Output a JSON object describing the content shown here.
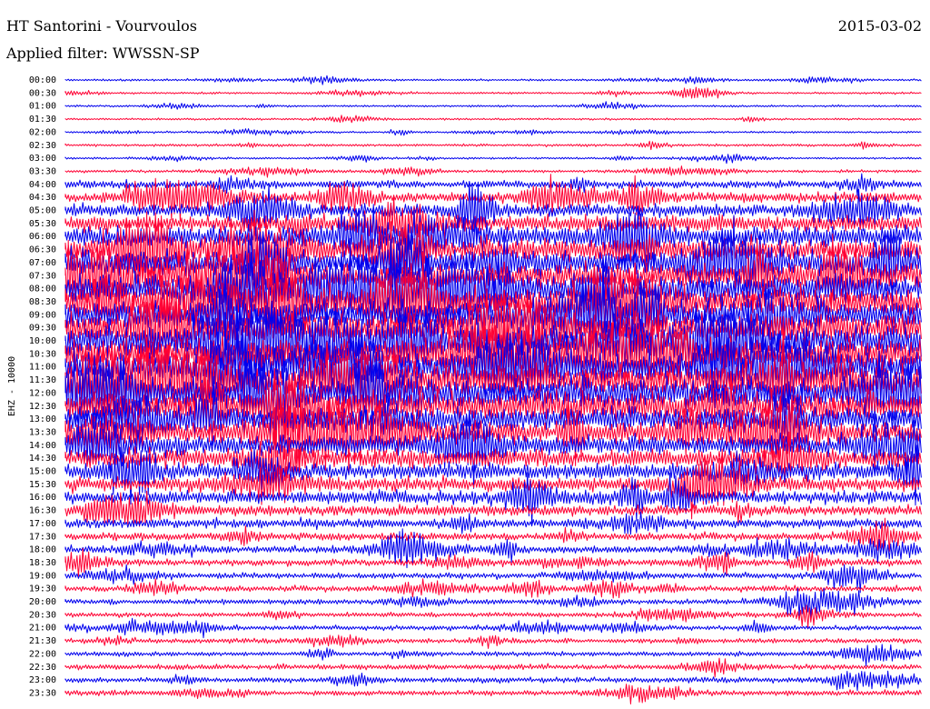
{
  "header": {
    "station": "HT Santorini - Vourvoulos",
    "date": "2015-03-02",
    "filter": "Applied filter: WWSSN-SP"
  },
  "colors": {
    "blue": "#0000ee",
    "red": "#ff0033",
    "background": "#ffffff"
  },
  "chart_data": {
    "type": "line",
    "title": "HT Santorini - Vourvoulos",
    "ylabel": "EHZ - 10000",
    "row_labels": [
      "00:00",
      "00:30",
      "01:00",
      "01:30",
      "02:00",
      "02:30",
      "03:00",
      "03:30",
      "04:00",
      "04:30",
      "05:00",
      "05:30",
      "06:00",
      "06:30",
      "07:00",
      "07:30",
      "08:00",
      "08:30",
      "09:00",
      "09:30",
      "10:00",
      "10:30",
      "11:00",
      "11:30",
      "12:00",
      "12:30",
      "13:00",
      "13:30",
      "14:00",
      "14:30",
      "15:00",
      "15:30",
      "16:00",
      "16:30",
      "17:00",
      "17:30",
      "18:00",
      "18:30",
      "19:00",
      "19:30",
      "20:00",
      "20:30",
      "21:00",
      "21:30",
      "22:00",
      "22:30",
      "23:00",
      "23:30"
    ],
    "row_colors": [
      "blue",
      "red",
      "blue",
      "red",
      "blue",
      "red",
      "blue",
      "red",
      "blue",
      "red",
      "blue",
      "red",
      "blue",
      "red",
      "blue",
      "red",
      "blue",
      "red",
      "blue",
      "red",
      "blue",
      "red",
      "blue",
      "red",
      "blue",
      "red",
      "blue",
      "red",
      "blue",
      "red",
      "blue",
      "red",
      "blue",
      "red",
      "blue",
      "red",
      "blue",
      "red",
      "blue",
      "red",
      "blue",
      "red",
      "blue",
      "red",
      "blue",
      "red",
      "blue",
      "red"
    ],
    "noise_level": [
      0.3,
      0.3,
      0.3,
      0.3,
      0.3,
      0.4,
      0.3,
      0.4,
      1.2,
      1.5,
      2.0,
      2.5,
      3.2,
      3.5,
      4.0,
      4.2,
      4.5,
      4.5,
      4.6,
      4.8,
      5.0,
      5.0,
      5.0,
      5.0,
      4.8,
      4.5,
      4.0,
      3.5,
      3.0,
      2.8,
      2.5,
      2.2,
      2.0,
      1.6,
      1.4,
      1.2,
      1.1,
      1.0,
      0.9,
      0.9,
      0.8,
      0.7,
      0.7,
      0.7,
      0.7,
      0.8,
      0.8,
      0.8
    ]
  }
}
